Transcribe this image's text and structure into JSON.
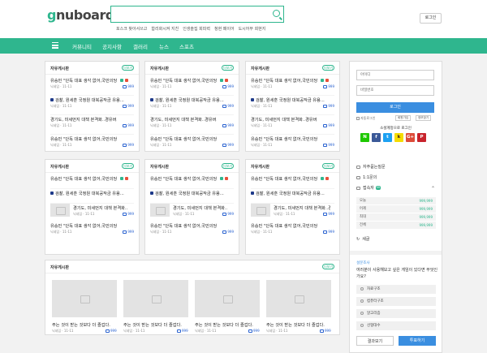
{
  "header": {
    "logo_text": "gnuboard",
    "login_label": "로그인",
    "search_placeholder": "",
    "popular": [
      "포스크 찾아서쓰고",
      "합리화시켜 지친",
      "인생솔집 회피력",
      "청현 페이어",
      "도시어부 회현지"
    ]
  },
  "nav": {
    "items": [
      "커뮤니티",
      "공지사항",
      "갤러리",
      "뉴스",
      "스포츠"
    ]
  },
  "boards": [
    {
      "title": "자유게시판",
      "more": "더보기",
      "posts": [
        {
          "title": "유승민 \"단독 대표 생각 없어,국민의당...",
          "meta": "닉네임 · 11-11",
          "count": "999",
          "cam": false,
          "tags": true
        },
        {
          "title": "검찰, 원세훈 국정원 대북공작금 유용...",
          "meta": "닉네임 · 11-11",
          "count": "999",
          "cam": true,
          "tags": false
        },
        {
          "title": "경기도, 미세먼지 대책 본격화..경유버스타고",
          "meta": "닉네임 · 11-11",
          "count": "999",
          "cam": false,
          "tags": false
        },
        {
          "title": "유승민 \"단독 대표 생각 없어,국민의당...",
          "meta": "닉네임 · 11-11",
          "count": "999",
          "cam": false,
          "tags": false
        }
      ]
    },
    {
      "title": "자유게시판",
      "more": "더보기",
      "posts": [
        {
          "title": "유승민 \"단독 대표 생각 없어,국민의당...",
          "meta": "닉네임 · 11-11",
          "count": "999",
          "cam": false,
          "tags": true
        },
        {
          "title": "검찰, 원세훈 국정원 대북공작금 유용...",
          "meta": "닉네임 · 11-11",
          "count": "999",
          "cam": true,
          "tags": false
        },
        {
          "title": "경기도, 미세먼지 대책 본격화..경유버스타고",
          "meta": "닉네임 · 11-11",
          "count": "999",
          "cam": false,
          "tags": false
        },
        {
          "title": "유승민 \"단독 대표 생각 없어,국민의당...",
          "meta": "닉네임 · 11-11",
          "count": "999",
          "cam": false,
          "tags": false
        }
      ]
    },
    {
      "title": "자유게시판",
      "more": "더보기",
      "posts": [
        {
          "title": "유승민 \"단독 대표 생각 없어,국민의당...",
          "meta": "닉네임 · 11-11",
          "count": "999",
          "cam": false,
          "tags": true
        },
        {
          "title": "검찰, 원세훈 국정원 대북공작금 유용...",
          "meta": "닉네임 · 11-11",
          "count": "999",
          "cam": true,
          "tags": false
        },
        {
          "title": "경기도, 미세먼지 대책 본격화..경유버스타고",
          "meta": "닉네임 · 11-11",
          "count": "999",
          "cam": false,
          "tags": false
        },
        {
          "title": "유승민 \"단독 대표 생각 없어,국민의당...",
          "meta": "닉네임 · 11-11",
          "count": "999",
          "cam": false,
          "tags": false
        }
      ]
    },
    {
      "title": "자유게시판",
      "more": "더보기",
      "posts": [
        {
          "title": "유승민 \"단독 대표 생각 없어,국민의당...",
          "meta": "",
          "count": "",
          "cam": false,
          "tags": true
        },
        {
          "title": "검찰, 원세훈 국정원 대북공작금 유용...",
          "meta": "",
          "count": "",
          "cam": true,
          "tags": false
        },
        {
          "title": "경기도, 미세먼지 대책 본격화..",
          "meta": "닉네임 · 11-11",
          "count": "999",
          "thumb": true
        },
        {
          "title": "유승민 \"단독 대표 생각 없어,국민의당...",
          "meta": "닉네임 · 11-11",
          "count": "999",
          "cam": false,
          "tags": false
        }
      ]
    },
    {
      "title": "자유게시판",
      "more": "더보기",
      "posts": [
        {
          "title": "유승민 \"단독 대표 생각 없어,국민의당...",
          "meta": "",
          "count": "",
          "cam": false,
          "tags": true
        },
        {
          "title": "검찰, 원세훈 국정원 대북공작금 유용...",
          "meta": "",
          "count": "",
          "cam": true,
          "tags": false
        },
        {
          "title": "경기도, 미세먼지 대책 본격화..",
          "meta": "닉네임 · 11-11",
          "count": "999",
          "thumb": true
        },
        {
          "title": "유승민 \"단독 대표 생각 없어,국민의당...",
          "meta": "닉네임 · 11-11",
          "count": "999",
          "cam": false,
          "tags": false
        }
      ]
    },
    {
      "title": "자유게시판",
      "more": "더보기",
      "posts": [
        {
          "title": "유승민 \"단독 대표 생각 없어,국민의당...",
          "meta": "",
          "count": "",
          "cam": false,
          "tags": true
        },
        {
          "title": "검찰, 원세훈 국정원 대북공작금 유용...",
          "meta": "",
          "count": "",
          "cam": true,
          "tags": false
        },
        {
          "title": "경기도, 미세먼지 대책 본격화..경유버스타고",
          "meta": "닉네임 · 11-11",
          "count": "999",
          "thumb": true
        },
        {
          "title": "유승민 \"단독 대표 생각 없어,국민의당...",
          "meta": "닉네임 · 11-11",
          "count": "999",
          "cam": false,
          "tags": false
        }
      ]
    }
  ],
  "gallery": {
    "title": "자유게시판",
    "more": "더보기",
    "items": [
      {
        "title": "주는 것이 받는 것보다 더 즐겁다.",
        "meta": "닉네임 · 11-11",
        "count": "999"
      },
      {
        "title": "주는 것이 받는 것보다 더 즐겁다.",
        "meta": "닉네임 · 11-11",
        "count": "999"
      },
      {
        "title": "주는 것이 받는 것보다 더 즐겁다.",
        "meta": "닉네임 · 11-11",
        "count": "999"
      },
      {
        "title": "주는 것이 받는 것보다 더 즐겁다.",
        "meta": "닉네임 · 11-11",
        "count": "999"
      }
    ]
  },
  "sidebar": {
    "id_placeholder": "아이디",
    "pw_placeholder": "비밀번호",
    "login_label": "로그인",
    "auto_login": "자동로그인",
    "join_label": "회원가입",
    "find_label": "정보찾기",
    "social_title": "소셜계정으로 로그인",
    "social": [
      {
        "t": "N",
        "c": "#1ec800"
      },
      {
        "t": "f",
        "c": "#3b5998"
      },
      {
        "t": "t",
        "c": "#1da1f2"
      },
      {
        "t": "k",
        "c": "#f5dc00"
      },
      {
        "t": "G+",
        "c": "#dd4b39"
      },
      {
        "t": "P",
        "c": "#c8232c"
      }
    ],
    "faq": "자주묻는질문",
    "qa": "1:1문의",
    "visitors": "접속자",
    "visitors_badge": "99",
    "stats": [
      {
        "label": "오늘",
        "value": "999,999"
      },
      {
        "label": "어제",
        "value": "999,999"
      },
      {
        "label": "최대",
        "value": "999,999"
      },
      {
        "label": "전체",
        "value": "999,999"
      }
    ],
    "search_label": "새글",
    "poll_label": "설문조사",
    "poll_question": "여러분이 사용해보고 싶은 게임이 있다면 무엇인가요?",
    "poll_options": [
      "자료구조",
      "컴퓨터구조",
      "알고리즘",
      "선형대수"
    ],
    "poll_result": "결과보기",
    "poll_vote": "투표하기"
  },
  "colors": {
    "accent": "#2fb68e",
    "link": "#2b63d0",
    "button": "#3a8ee0"
  }
}
